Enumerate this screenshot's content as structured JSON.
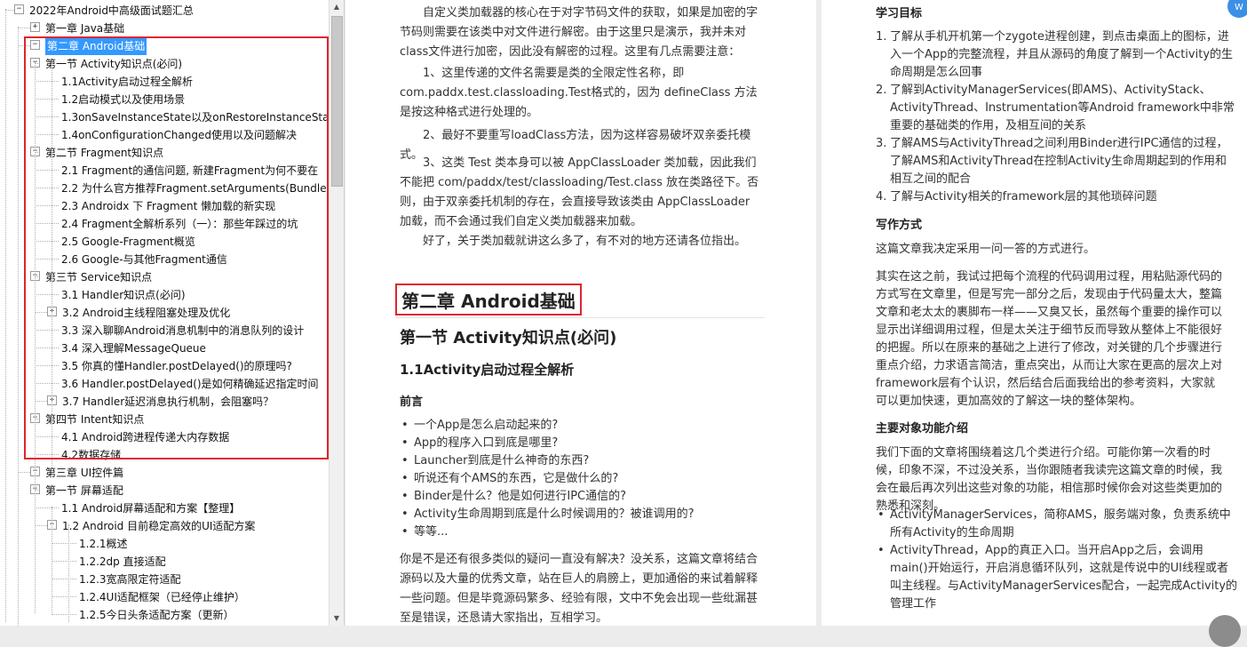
{
  "tree": {
    "rows": [
      {
        "label": "2022年Android中高级面试题汇总",
        "toggle": "−"
      },
      {
        "label": "第一章 Java基础",
        "toggle": "+"
      },
      {
        "label": "第二章 Android基础",
        "toggle": "−"
      },
      {
        "label": "第一节 Activity知识点(必问)",
        "toggle": "−"
      },
      {
        "label": "1.1Activity启动过程全解析",
        "toggle": ""
      },
      {
        "label": "1.2启动模式以及使用场景",
        "toggle": ""
      },
      {
        "label": "1.3onSaveInstanceState以及onRestoreInstanceSta",
        "toggle": ""
      },
      {
        "label": "1.4onConfigurationChanged使用以及问题解决",
        "toggle": ""
      },
      {
        "label": "第二节 Fragment知识点",
        "toggle": "−"
      },
      {
        "label": "2.1 Fragment的通信问题, 新建Fragment为何不要在",
        "toggle": ""
      },
      {
        "label": "2.2 为什么官方推荐Fragment.setArguments(Bundle",
        "toggle": ""
      },
      {
        "label": "2.3 Androidx 下 Fragment 懒加载的新实现",
        "toggle": ""
      },
      {
        "label": "2.4 Fragment全解析系列（一）：那些年踩过的坑",
        "toggle": ""
      },
      {
        "label": "2.5 Google-Fragment概览",
        "toggle": ""
      },
      {
        "label": "2.6 Google-与其他Fragment通信",
        "toggle": ""
      },
      {
        "label": "第三节 Service知识点",
        "toggle": "−"
      },
      {
        "label": "3.1 Handler知识点(必问)",
        "toggle": ""
      },
      {
        "label": "3.2 Android主线程阻塞处理及优化",
        "toggle": "+"
      },
      {
        "label": "3.3 深入聊聊Android消息机制中的消息队列的设计",
        "toggle": ""
      },
      {
        "label": "3.4 深入理解MessageQueue",
        "toggle": ""
      },
      {
        "label": "3.5 你真的懂Handler.postDelayed()的原理吗?",
        "toggle": ""
      },
      {
        "label": "3.6 Handler.postDelayed()是如何精确延迟指定时间",
        "toggle": ""
      },
      {
        "label": "3.7 Handler延迟消息执行机制，会阻塞吗？",
        "toggle": "+"
      },
      {
        "label": "第四节 Intent知识点",
        "toggle": "−"
      },
      {
        "label": "4.1 Android跨进程传递大内存数据",
        "toggle": ""
      },
      {
        "label": "4.2数据存储",
        "toggle": ""
      },
      {
        "label": "第三章 UI控件篇",
        "toggle": "−"
      },
      {
        "label": "第一节 屏幕适配",
        "toggle": "−"
      },
      {
        "label": "1.1 Android屏幕适配和方案【整理】",
        "toggle": ""
      },
      {
        "label": "1.2 Android 目前稳定高效的UI适配方案",
        "toggle": "−"
      },
      {
        "label": "1.2.1概述",
        "toggle": ""
      },
      {
        "label": "1.2.2dp 直接适配",
        "toggle": ""
      },
      {
        "label": "1.2.3宽高限定符适配",
        "toggle": ""
      },
      {
        "label": "1.2.4UI适配框架（已经停止维护）",
        "toggle": ""
      },
      {
        "label": "1.2.5今日头条适配方案（更新）",
        "toggle": ""
      }
    ]
  },
  "middle": {
    "intro_paragraph": "自定义类加载器的核心在于对字节码文件的获取，如果是加密的字节码则需要在该类中对文件进行解密。由于这里只是演示，我并未对class文件进行加密，因此没有解密的过程。这里有几点需要注意：",
    "note_1": "1、这里传递的文件名需要是类的全限定性名称，即com.paddx.test.classloading.Test格式的，因为 defineClass 方法是按这种格式进行处理的。",
    "note_2": "2、最好不要重写loadClass方法，因为这样容易破坏双亲委托模式。",
    "note_3": "3、这类 Test 类本身可以被 AppClassLoader 类加载，因此我们不能把 com/paddx/test/classloading/Test.class 放在类路径下。否则，由于双亲委托机制的存在，会直接导致该类由 AppClassLoader 加载，而不会通过我们自定义类加载器来加载。",
    "closing": "好了，关于类加载就讲这么多了，有不对的地方还请各位指出。",
    "chapter_heading": "第二章 Android基础",
    "section_heading": "第一节 Activity知识点(必问)",
    "sub_heading": "1.1Activity启动过程全解析",
    "preface_heading": "前言",
    "bullets": [
      "一个App是怎么启动起来的?",
      "App的程序入口到底是哪里?",
      "Launcher到底是什么神奇的东西?",
      "听说还有个AMS的东西，它是做什么的?",
      "Binder是什么？他是如何进行IPC通信的?",
      "Activity生命周期到底是什么时候调用的？被谁调用的?",
      "等等..."
    ],
    "bottom_paragraph": "你是不是还有很多类似的疑问一直没有解决？没关系，这篇文章将结合源码以及大量的优秀文章，站在巨人的肩膀上，更加通俗的来试着解释一些问题。但是毕竟源码繁多、经验有限，文中不免会出现一些纰漏甚至是错误，还恳请大家指出，互相学习。"
  },
  "right": {
    "goals_heading": "学习目标",
    "goals": [
      {
        "num": "1.",
        "text": "了解从手机开机第一个zygote进程创建，到点击桌面上的图标，进入一个App的完整流程，并且从源码的角度了解到一个Activity的生命周期是怎么回事"
      },
      {
        "num": "2.",
        "text": "了解到ActivityManagerServices(即AMS)、ActivityStack、ActivityThread、Instrumentation等Android framework中非常重要的基础类的作用，及相互间的关系"
      },
      {
        "num": "3.",
        "text": "了解AMS与ActivityThread之间利用Binder进行IPC通信的过程，了解AMS和ActivityThread在控制Activity生命周期起到的作用和相互之间的配合"
      },
      {
        "num": "4.",
        "text": "了解与Activity相关的framework层的其他琐碎问题"
      }
    ],
    "writing_heading": "写作方式",
    "writing_para": "这篇文章我决定采用一问一答的方式进行。",
    "long_para": "其实在这之前，我试过把每个流程的代码调用过程，用粘贴源代码的方式写在文章里，但是写完一部分之后，发现由于代码量太大，整篇文章和老太太的裹脚布一样——又臭又长，虽然每个重要的操作可以显示出详细调用过程，但是太关注于细节反而导致从整体上不能很好的把握。所以在原来的基础之上进行了修改，对关键的几个步骤进行重点介绍，力求语言简洁，重点突出，从而让大家在更高的层次上对framework层有个认识，然后结合后面我给出的参考资料，大家就可以更加快速，更加高效的了解这一块的整体架构。",
    "objects_heading": "主要对象功能介绍",
    "objects_para": "我们下面的文章将围绕着这几个类进行介绍。可能你第一次看的时候，印象不深，不过没关系，当你跟随者我读完这篇文章的时候，我会在最后再次列出这些对象的功能，相信那时候你会对这些类更加的熟悉和深刻。",
    "objects_bullets": [
      "ActivityManagerServices，简称AMS，服务端对象，负责系统中所有Activity的生命周期",
      "ActivityThread，App的真正入口。当开启App之后，会调用main()开始运行，开启消息循环队列，这就是传说中的UI线程或者叫主线程。与ActivityManagerServices配合，一起完成Activity的管理工作"
    ]
  },
  "colors": {
    "selection": "#3399ff",
    "highlight_border": "#e0242f",
    "background": "#ececec",
    "corner_badge": "#3b8fe6"
  },
  "icons": {
    "expand": "plus-toggle-icon",
    "collapse": "minus-toggle-icon",
    "scroll_up": "scroll-up-arrow-icon",
    "scroll_down": "scroll-down-arrow-icon",
    "corner_badge": "app-badge-icon",
    "scroll_top": "scroll-to-top-icon"
  }
}
